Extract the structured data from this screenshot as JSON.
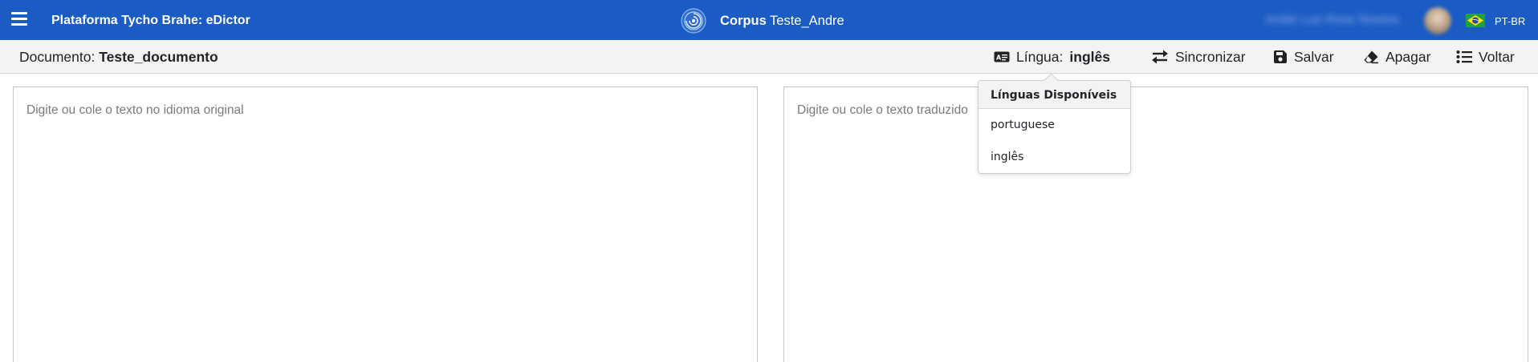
{
  "header": {
    "app_title": "Plataforma Tycho Brahe: eDictor",
    "corpus_label": "Corpus",
    "corpus_name": "Teste_Andre",
    "user_name": "André Luiz Rosa Teixeira",
    "locale": "PT-BR",
    "menu_icon": "hamburger-menu-icon",
    "logo_icon": "spiral-logo-icon",
    "flag_icon": "brazil-flag-icon"
  },
  "toolbar": {
    "document_label": "Documento:",
    "document_name": "Teste_documento",
    "language_label": "Língua:",
    "language_value": "inglês",
    "sync_label": "Sincronizar",
    "save_label": "Salvar",
    "erase_label": "Apagar",
    "back_label": "Voltar"
  },
  "editors": {
    "original_placeholder": "Digite ou cole o texto no idioma original",
    "translated_placeholder": "Digite ou cole o texto traduzido"
  },
  "language_dropdown": {
    "header": "Línguas Disponíveis",
    "options": [
      "portuguese",
      "inglês"
    ]
  },
  "colors": {
    "primary": "#1a5bc4",
    "toolbar_bg": "#f3f3f3"
  }
}
